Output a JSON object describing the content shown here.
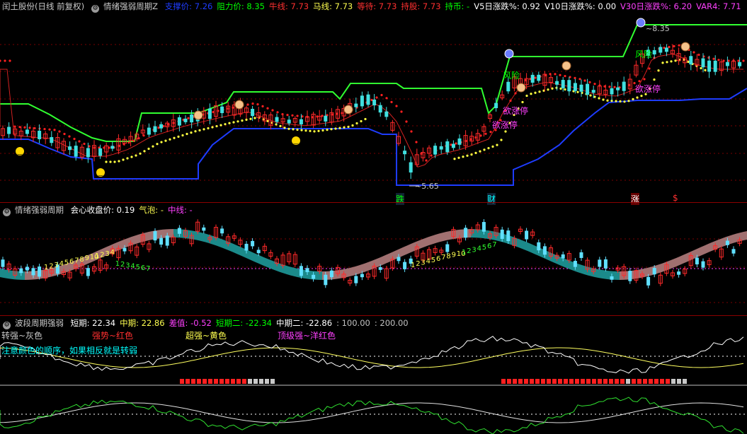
{
  "panel1": {
    "title": "闰土股份(日线 前复权)",
    "indicator": "情绪强弱周期Z",
    "stats": [
      {
        "label": "支撑价: 7.26",
        "color": "#1e3cff"
      },
      {
        "label": "阻力价: 8.35",
        "color": "#00ff00"
      },
      {
        "label": "牛线: 7.73",
        "color": "#ff3030"
      },
      {
        "label": "马线: 7.73",
        "color": "#ffff50"
      },
      {
        "label": "等待: 7.73",
        "color": "#ff3030"
      },
      {
        "label": "持股: 7.73",
        "color": "#ff3030"
      },
      {
        "label": "持币: -",
        "color": "#00ff00"
      },
      {
        "label": "V5日涨跌%: 0.92",
        "color": "#ffffff"
      },
      {
        "label": "V10日涨跌%: 0.00",
        "color": "#ffffff"
      },
      {
        "label": "V30日涨跌%: 6.20",
        "color": "#ff40ff"
      },
      {
        "label": "VAR4: 7.71",
        "color": "#ff40ff"
      }
    ],
    "annotations": {
      "high": "~8.35",
      "low": "~5.65",
      "risk1": "风险",
      "risk2": "风险",
      "zt1": "欲涨停",
      "zt2": "欲涨停",
      "zt3": "欲涨停",
      "bottom1": "跌",
      "bottom2": "财",
      "bottom3": "涨",
      "bottom4": "$"
    }
  },
  "panel2": {
    "indicator": "情绪强弱周期",
    "stats": [
      {
        "label": "会心收盘价: 0.19",
        "color": "#ffffff"
      },
      {
        "label": "气泡: -",
        "color": "#ffff50"
      },
      {
        "label": "中线: -",
        "color": "#ff40ff"
      }
    ],
    "count1": [
      "1",
      "2",
      "3",
      "4",
      "5",
      "6",
      "7",
      "8",
      "9",
      "10",
      "1",
      "2",
      "3",
      "4",
      "1",
      "2",
      "3",
      "4",
      "5",
      "6",
      "7"
    ],
    "count2": [
      "1",
      "2",
      "3",
      "4",
      "5",
      "6",
      "7",
      "8",
      "9",
      "10",
      "1",
      "2",
      "3",
      "4",
      "5",
      "6",
      "7"
    ]
  },
  "panel3": {
    "indicator": "波段周期强弱",
    "stats": [
      {
        "label": "短期: 22.34",
        "color": "#ffffff"
      },
      {
        "label": "中期: 22.86",
        "color": "#ffff50"
      },
      {
        "label": "差值: -0.52",
        "color": "#ff40ff"
      },
      {
        "label": "短期二: -22.34",
        "color": "#00ff00"
      },
      {
        "label": "中期二: -22.86",
        "color": "#ffffff"
      },
      {
        "label": ": 100.00",
        "color": "#c0c0c0"
      },
      {
        "label": ": 200.00",
        "color": "#c0c0c0"
      }
    ],
    "legend": [
      {
        "label": "转强~灰色",
        "color": "#c8c8c8"
      },
      {
        "label": "强势~红色",
        "color": "#ff3030"
      },
      {
        "label": "超强~黄色",
        "color": "#ffff50"
      },
      {
        "label": "顶级强~洋红色",
        "color": "#ff40ff"
      }
    ],
    "note": "注意颜色的顺序，如果相反就是转弱",
    "note_color": "#00ffff"
  }
}
